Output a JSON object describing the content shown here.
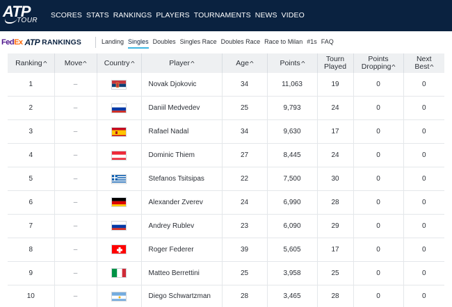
{
  "header": {
    "logo_text": "ATP",
    "logo_sub": "TOUR",
    "nav": [
      "SCORES",
      "STATS",
      "RANKINGS",
      "PLAYERS",
      "TOURNAMENTS",
      "NEWS",
      "VIDEO"
    ]
  },
  "subnav": {
    "sponsor_fed": "Fed",
    "sponsor_ex": "Ex",
    "brand_atp": "ATP",
    "brand_title": "RANKINGS",
    "links": [
      "Landing",
      "Singles",
      "Doubles",
      "Singles Race",
      "Doubles Race",
      "Race to Milan",
      "#1s",
      "FAQ"
    ],
    "active": "Singles"
  },
  "table": {
    "columns": [
      {
        "label": "Ranking",
        "sortable": true
      },
      {
        "label": "Move",
        "sortable": true
      },
      {
        "label": "Country",
        "sortable": true
      },
      {
        "label": "Player",
        "sortable": true
      },
      {
        "label": "Age",
        "sortable": true
      },
      {
        "label": "Points",
        "sortable": true
      },
      {
        "label_line1": "Tourn",
        "label_line2": "Played",
        "sortable": false
      },
      {
        "label_line1": "Points",
        "label_line2": "Dropping",
        "sortable": true
      },
      {
        "label_line1": "Next",
        "label_line2": "Best",
        "sortable": true
      }
    ],
    "rows": [
      {
        "rank": "1",
        "move": "–",
        "flag": "srb",
        "player": "Novak Djokovic",
        "age": "34",
        "points": "11,063",
        "played": "19",
        "dropping": "0",
        "next": "0"
      },
      {
        "rank": "2",
        "move": "–",
        "flag": "rus",
        "player": "Daniil Medvedev",
        "age": "25",
        "points": "9,793",
        "played": "24",
        "dropping": "0",
        "next": "0"
      },
      {
        "rank": "3",
        "move": "–",
        "flag": "esp",
        "player": "Rafael Nadal",
        "age": "34",
        "points": "9,630",
        "played": "17",
        "dropping": "0",
        "next": "0"
      },
      {
        "rank": "4",
        "move": "–",
        "flag": "aut",
        "player": "Dominic Thiem",
        "age": "27",
        "points": "8,445",
        "played": "24",
        "dropping": "0",
        "next": "0"
      },
      {
        "rank": "5",
        "move": "–",
        "flag": "gre",
        "player": "Stefanos Tsitsipas",
        "age": "22",
        "points": "7,500",
        "played": "30",
        "dropping": "0",
        "next": "0"
      },
      {
        "rank": "6",
        "move": "–",
        "flag": "ger",
        "player": "Alexander Zverev",
        "age": "24",
        "points": "6,990",
        "played": "28",
        "dropping": "0",
        "next": "0"
      },
      {
        "rank": "7",
        "move": "–",
        "flag": "rus",
        "player": "Andrey Rublev",
        "age": "23",
        "points": "6,090",
        "played": "29",
        "dropping": "0",
        "next": "0"
      },
      {
        "rank": "8",
        "move": "–",
        "flag": "sui",
        "player": "Roger Federer",
        "age": "39",
        "points": "5,605",
        "played": "17",
        "dropping": "0",
        "next": "0"
      },
      {
        "rank": "9",
        "move": "–",
        "flag": "ita",
        "player": "Matteo Berrettini",
        "age": "25",
        "points": "3,958",
        "played": "25",
        "dropping": "0",
        "next": "0"
      },
      {
        "rank": "10",
        "move": "–",
        "flag": "arg",
        "player": "Diego Schwartzman",
        "age": "28",
        "points": "3,465",
        "played": "28",
        "dropping": "0",
        "next": "0"
      }
    ]
  },
  "colors": {
    "nav_bg": "#0a2240",
    "accent": "#3cb6e3",
    "header_row_bg": "#eef0f2"
  }
}
